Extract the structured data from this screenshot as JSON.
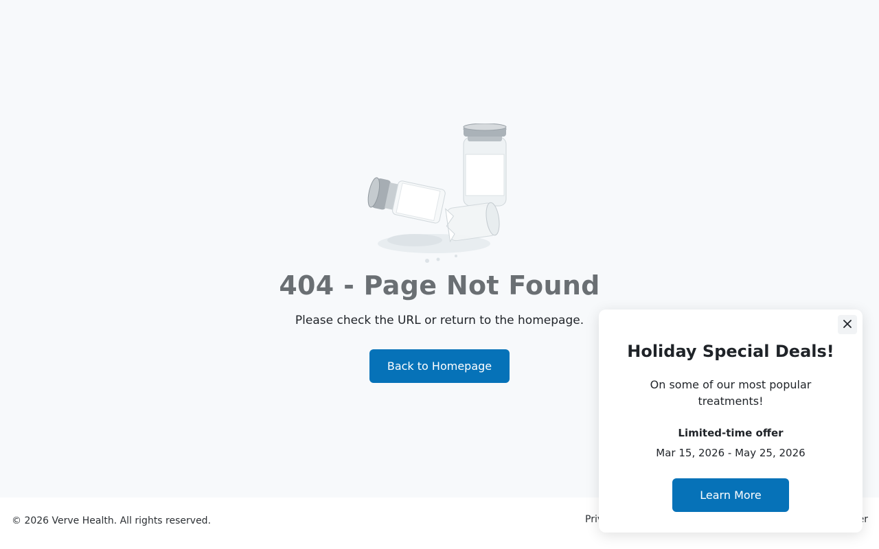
{
  "page": {
    "title": "404 - Page Not Found",
    "message": "Please check the URL or return to the homepage.",
    "home_button": "Back to Homepage",
    "illustration": "broken-vials-illustration"
  },
  "footer": {
    "copyright": "© 2026 Verve Health. All rights reserved.",
    "link_privacy": "Priv",
    "link_disclaimer": "er"
  },
  "popup": {
    "title": "Holiday Special Deals!",
    "description": "On some of our most popular treatments!",
    "offer_label": "Limited-time offer",
    "dates": "Mar 15, 2026 - May 25, 2026",
    "button": "Learn More",
    "close_icon": "close-icon"
  },
  "colors": {
    "accent": "#0672b8",
    "background": "#f7f9fb",
    "title_gray": "#6a6f73"
  }
}
